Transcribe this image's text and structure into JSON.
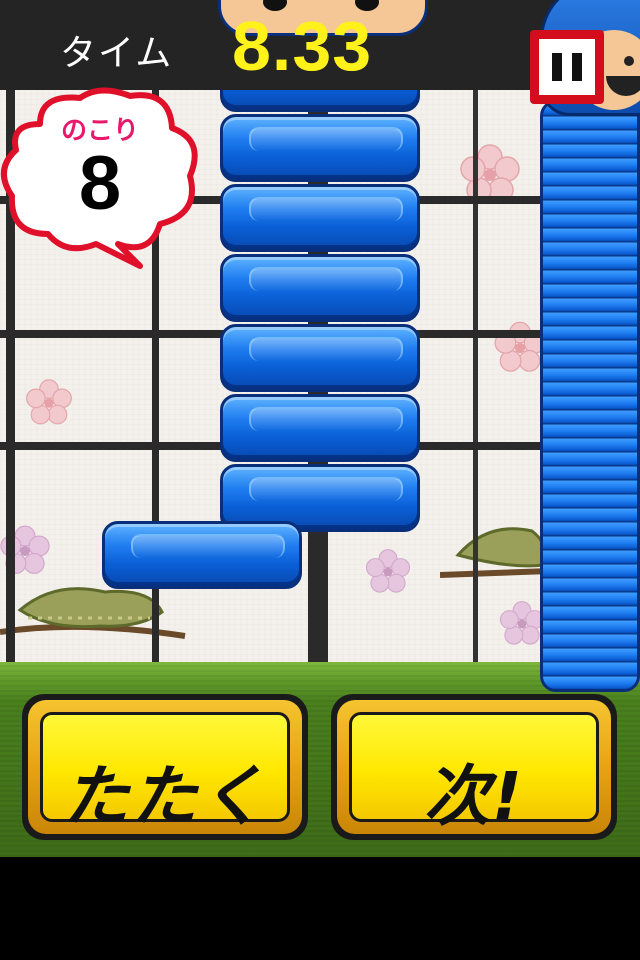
{
  "hud": {
    "time_label": "タイム",
    "time_value": "8.33",
    "remaining_label": "のこり",
    "remaining_value": "8"
  },
  "controls": {
    "hit_label": "たたく",
    "next_label": "次!"
  },
  "colors": {
    "block_blue": "#1f7df0",
    "time_yellow": "#fff21a",
    "button_yellow": "#ffe700",
    "pause_red": "#d40d1c",
    "remaining_pink": "#e8186c",
    "ground_green": "#5f9a2a"
  },
  "icons": {
    "pause": "pause-icon",
    "blossom": "cherry-blossom-icon",
    "pine": "pine-branch-icon"
  }
}
